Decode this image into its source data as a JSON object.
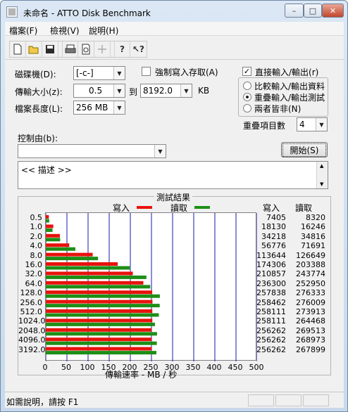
{
  "window": {
    "title": "未命名 - ATTO Disk Benchmark",
    "min_glyph": "–",
    "max_glyph": "□",
    "close_glyph": "✕"
  },
  "menu": {
    "items": [
      "檔案(F)",
      "檢視(V)",
      "說明(H)"
    ]
  },
  "toolbar": {
    "icons": [
      "new-icon",
      "open-icon",
      "save-icon",
      "print-icon",
      "print-preview-icon",
      "move-icon",
      "help-icon",
      "context-help-icon"
    ]
  },
  "form": {
    "drive_label": "磁碟機(D):",
    "drive_value": "[-c-]",
    "transfer_label": "傳輸大小(z):",
    "transfer_from": "0.5",
    "to_label": "到",
    "transfer_to": "8192.0",
    "kb_label": "KB",
    "length_label": "檔案長度(L):",
    "length_value": "256 MB",
    "force_write_label": "強制寫入存取(A)",
    "force_write_checked": false,
    "direct_io_label": "直接輸入/輸出(r)",
    "direct_io_checked": true,
    "io_options": [
      "比較輸入/輸出資料",
      "重疊輸入/輸出測試",
      "兩者皆非(N)"
    ],
    "io_selected": 1,
    "queue_label": "重疊項目數",
    "queue_value": "4",
    "controlled_label": "控制由(b):",
    "controlled_value": "",
    "start_button": "開始(S)",
    "description_text": "<<    描述    >>"
  },
  "results": {
    "title": "測試結果",
    "legend_write": "寫入",
    "legend_read": "讀取",
    "col_write": "寫入",
    "col_read": "讀取",
    "x_axis_label": "傳輸速率 - MB / 秒",
    "write_color": "#e8120c",
    "read_color": "#1d8f17"
  },
  "chart_data": {
    "type": "bar",
    "orientation": "horizontal",
    "categories": [
      "0.5",
      "1.0",
      "2.0",
      "4.0",
      "8.0",
      "16.0",
      "32.0",
      "64.0",
      "128.0",
      "256.0",
      "512.0",
      "1024.0",
      "2048.0",
      "4096.0",
      "3192.0"
    ],
    "series": [
      {
        "name": "寫入",
        "values": [
          7405,
          18130,
          34218,
          56776,
          113644,
          174306,
          210857,
          236300,
          257838,
          258462,
          258111,
          258111,
          256262,
          256262,
          256262
        ]
      },
      {
        "name": "讀取",
        "values": [
          8320,
          16246,
          34816,
          71691,
          126649,
          203388,
          243774,
          252950,
          276333,
          276009,
          273913,
          264468,
          269513,
          268973,
          267899
        ]
      }
    ],
    "write_text": [
      "7405",
      "18130",
      "34218",
      "56776",
      "113644",
      "174306",
      "210857",
      "236300",
      "257838",
      "258462",
      "258111",
      "258111",
      "256262",
      "256262",
      "256262"
    ],
    "read_text": [
      "8320",
      "16246",
      "34816",
      "71691",
      "126649",
      "203388",
      "243774",
      "252950",
      "276333",
      "276009",
      "273913",
      "264468",
      "269513",
      "268973",
      "267899"
    ],
    "xticks": [
      "0",
      "50",
      "100",
      "150",
      "200",
      "250",
      "300",
      "350",
      "400",
      "450",
      "500"
    ],
    "xlim": [
      0,
      500
    ],
    "xlabel": "傳輸速率 - MB / 秒",
    "grid": true
  },
  "status": {
    "text": "如需說明，請按 F1"
  }
}
